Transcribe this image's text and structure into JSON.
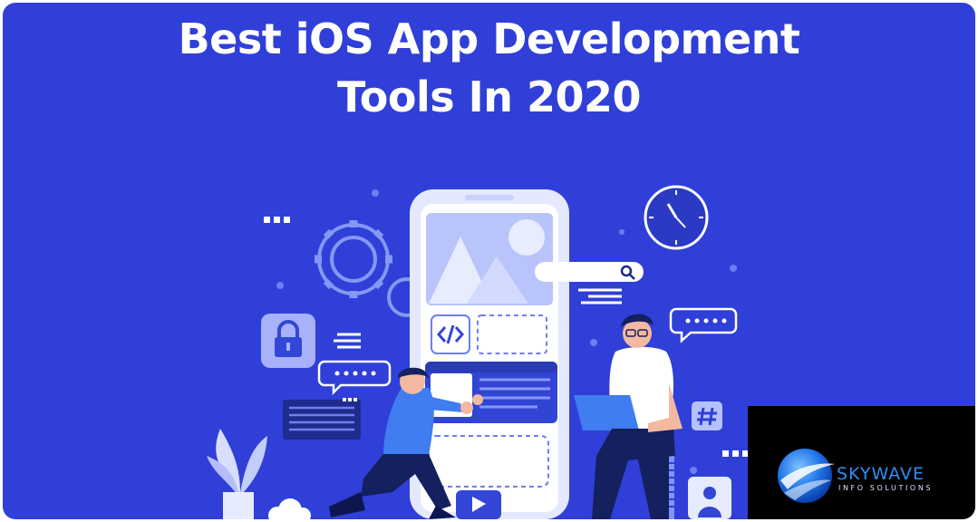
{
  "banner": {
    "title_line1": "Best iOS App Development",
    "title_line2": "Tools In 2020"
  },
  "logo": {
    "name": "SKYWAVE",
    "tagline": "INFO SOLUTIONS"
  },
  "colors": {
    "background": "#2f3fd8",
    "phone": "#e3e8ff",
    "accent_dark": "#1d2a8a",
    "logo_blue": "#2f8cf5"
  },
  "icons": [
    "gear-icon",
    "clock-icon",
    "search-icon",
    "code-icon",
    "lock-icon",
    "hash-icon",
    "chat-bubble-icon",
    "play-icon",
    "user-icon",
    "plant-icon"
  ]
}
